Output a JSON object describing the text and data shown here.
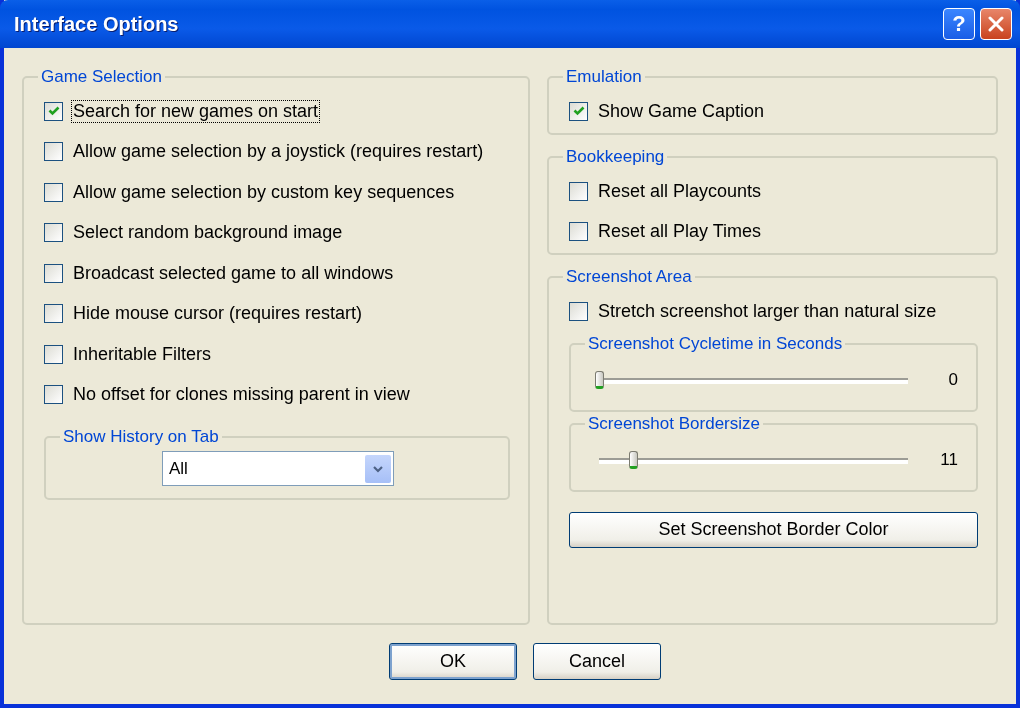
{
  "window": {
    "title": "Interface Options",
    "help_button": "?"
  },
  "game_selection": {
    "title": "Game Selection",
    "options": [
      {
        "label": "Search for new games on start",
        "checked": true,
        "focused": true
      },
      {
        "label": "Allow game selection by a joystick (requires restart)",
        "checked": false,
        "focused": false
      },
      {
        "label": "Allow game selection by custom key sequences",
        "checked": false,
        "focused": false
      },
      {
        "label": "Select random background image",
        "checked": false,
        "focused": false
      },
      {
        "label": "Broadcast selected game to all windows",
        "checked": false,
        "focused": false
      },
      {
        "label": "Hide mouse cursor (requires restart)",
        "checked": false,
        "focused": false
      },
      {
        "label": "Inheritable Filters",
        "checked": false,
        "focused": false
      },
      {
        "label": "No offset for clones missing parent in view",
        "checked": false,
        "focused": false
      }
    ],
    "history": {
      "title": "Show History on Tab",
      "value": "All"
    }
  },
  "emulation": {
    "title": "Emulation",
    "options": [
      {
        "label": "Show Game Caption",
        "checked": true,
        "focused": false
      }
    ]
  },
  "bookkeeping": {
    "title": "Bookkeeping",
    "options": [
      {
        "label": "Reset all Playcounts",
        "checked": false,
        "focused": false
      },
      {
        "label": "Reset all Play Times",
        "checked": false,
        "focused": false
      }
    ]
  },
  "screenshot_area": {
    "title": "Screenshot Area",
    "options": [
      {
        "label": "Stretch screenshot larger than natural size",
        "checked": false,
        "focused": false
      }
    ],
    "sliders": [
      {
        "title": "Screenshot Cycletime in Seconds",
        "level": 0,
        "reading": "0"
      },
      {
        "title": "Screenshot Bordersize",
        "level": 0.11,
        "reading": "11"
      }
    ],
    "button": "Set Screenshot Border Color"
  },
  "buttons": [
    {
      "label": "OK",
      "default": true
    },
    {
      "label": "Cancel",
      "default": false
    }
  ]
}
